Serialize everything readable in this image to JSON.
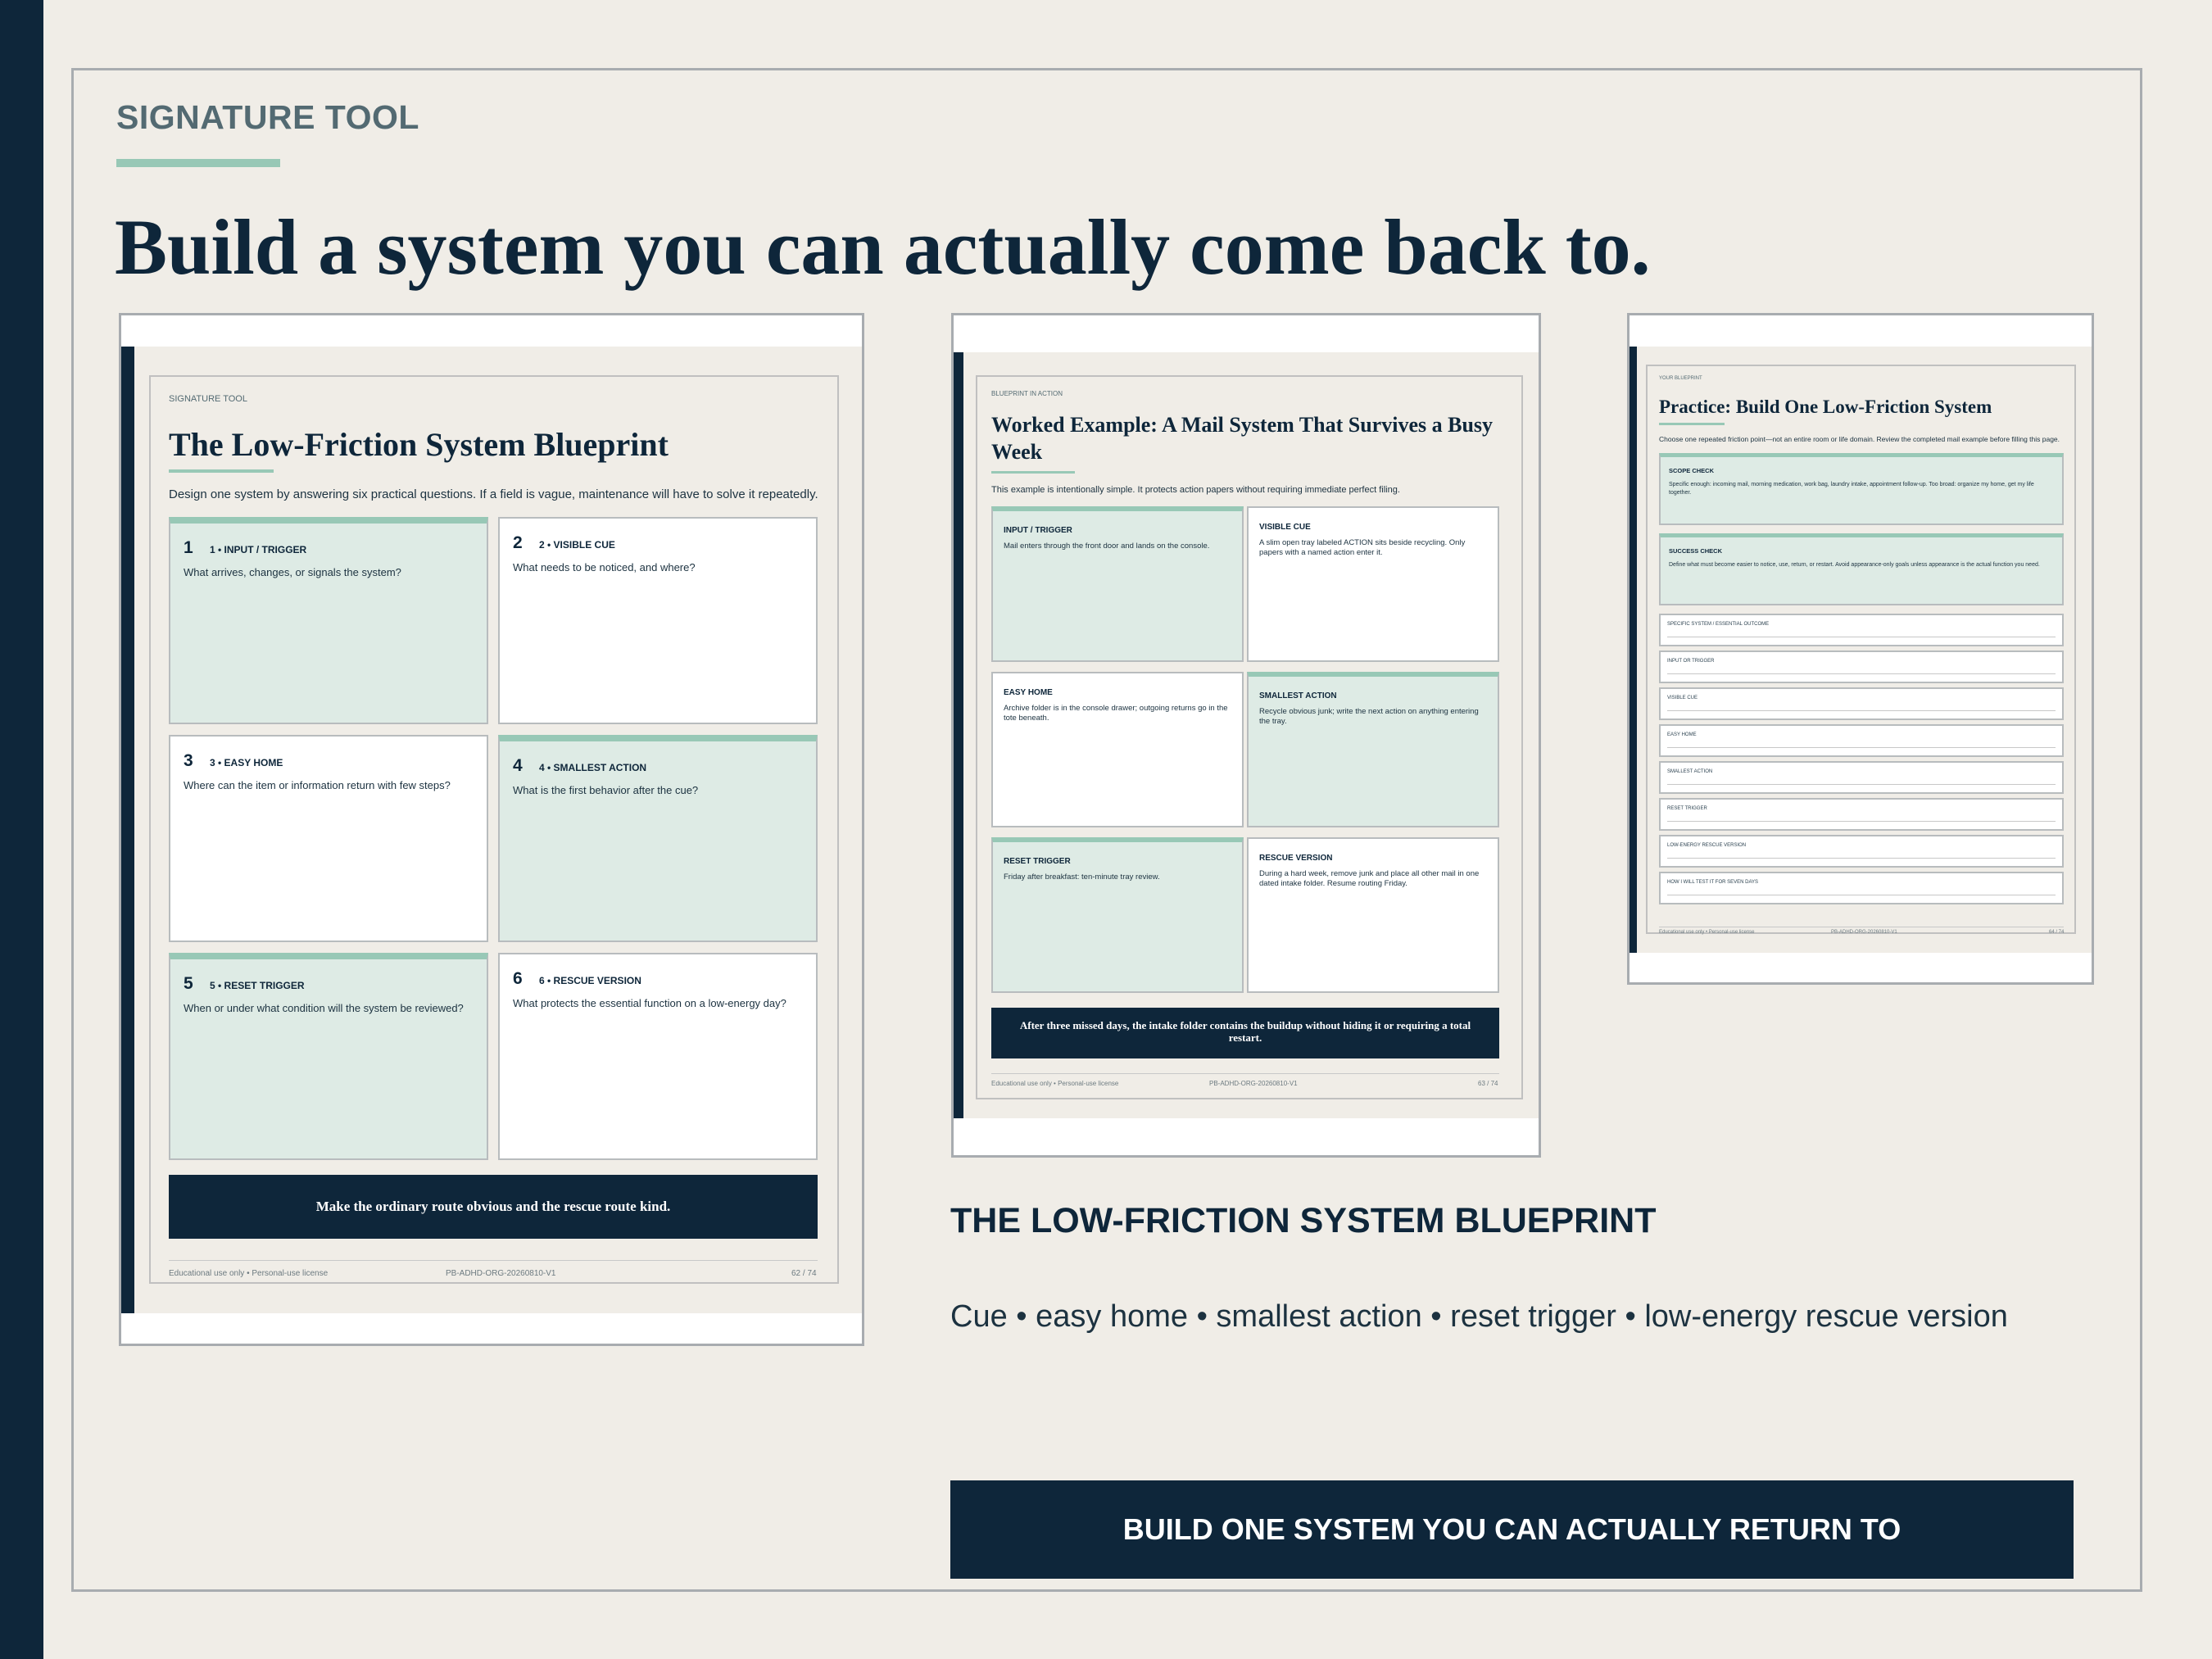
{
  "eyebrow": "SIGNATURE TOOL",
  "headline": "Build a system you can actually come back to.",
  "preview1": {
    "eyebrow": "SIGNATURE TOOL",
    "title": "The Low-Friction System Blueprint",
    "description": "Design one system by answering six practical questions. If a field is vague, maintenance will have to solve it repeatedly.",
    "cells": [
      {
        "num": "1",
        "label": "1 • INPUT / TRIGGER",
        "question": "What arrives, changes, or signals the system?",
        "style": "teal"
      },
      {
        "num": "2",
        "label": "2 • VISIBLE CUE",
        "question": "What needs to be noticed, and where?",
        "style": "white"
      },
      {
        "num": "3",
        "label": "3 • EASY HOME",
        "question": "Where can the item or information return with few steps?",
        "style": "white"
      },
      {
        "num": "4",
        "label": "4 • SMALLEST ACTION",
        "question": "What is the first behavior after the cue?",
        "style": "teal"
      },
      {
        "num": "5",
        "label": "5 • RESET TRIGGER",
        "question": "When or under what condition will the system be reviewed?",
        "style": "teal"
      },
      {
        "num": "6",
        "label": "6 • RESCUE VERSION",
        "question": "What protects the essential function on a low-energy day?",
        "style": "white"
      }
    ],
    "banner": "Make the ordinary route obvious and the rescue route kind.",
    "footer_left": "Educational use only • Personal-use license",
    "footer_mid": "PB-ADHD-ORG-20260810-V1",
    "footer_right": "62 / 74"
  },
  "preview2": {
    "eyebrow": "BLUEPRINT IN ACTION",
    "title": "Worked Example: A Mail System That Survives a Busy Week",
    "description": "This example is intentionally simple. It protects action papers without requiring immediate perfect filing.",
    "cells": [
      {
        "label": "INPUT / TRIGGER",
        "text": "Mail enters through the front door and lands on the console.",
        "style": "teal"
      },
      {
        "label": "VISIBLE CUE",
        "text": "A slim open tray labeled ACTION sits beside recycling. Only papers with a named action enter it.",
        "style": "white"
      },
      {
        "label": "EASY HOME",
        "text": "Archive folder is in the console drawer; outgoing returns go in the tote beneath.",
        "style": "white"
      },
      {
        "label": "SMALLEST ACTION",
        "text": "Recycle obvious junk; write the next action on anything entering the tray.",
        "style": "teal"
      },
      {
        "label": "RESET TRIGGER",
        "text": "Friday after breakfast: ten-minute tray review.",
        "style": "teal"
      },
      {
        "label": "RESCUE VERSION",
        "text": "During a hard week, remove junk and place all other mail in one dated intake folder. Resume routing Friday.",
        "style": "white"
      }
    ],
    "banner": "After three missed days, the intake folder contains the buildup without hiding it or requiring a total restart.",
    "footer_left": "Educational use only • Personal-use license",
    "footer_mid": "PB-ADHD-ORG-20260810-V1",
    "footer_right": "63 / 74"
  },
  "preview3": {
    "eyebrow": "YOUR BLUEPRINT",
    "title": "Practice: Build One Low-Friction System",
    "description": "Choose one repeated friction point—not an entire room or life domain. Review the completed mail example before filling this page.",
    "scope_label": "SCOPE CHECK",
    "scope_text": "Specific enough: incoming mail, morning medication, work bag, laundry intake, appointment follow-up. Too broad: organize my home, get my life together.",
    "success_label": "SUCCESS CHECK",
    "success_text": "Define what must become easier to notice, use, return, or restart. Avoid appearance-only goals unless appearance is the actual function you need.",
    "fields": [
      "SPECIFIC SYSTEM / ESSENTIAL OUTCOME",
      "INPUT OR TRIGGER",
      "VISIBLE CUE",
      "EASY HOME",
      "SMALLEST ACTION",
      "RESET TRIGGER",
      "LOW-ENERGY RESCUE VERSION",
      "HOW I WILL TEST IT FOR SEVEN DAYS"
    ],
    "footer_left": "Educational use only • Personal-use license",
    "footer_mid": "PB-ADHD-ORG-20260810-V1",
    "footer_right": "64 / 74"
  },
  "side_title": "THE LOW-FRICTION SYSTEM BLUEPRINT",
  "side_subtitle": "Cue • easy home • smallest action • reset trigger • low-energy rescue version",
  "cta_label": "BUILD ONE SYSTEM YOU CAN ACTUALLY RETURN TO"
}
